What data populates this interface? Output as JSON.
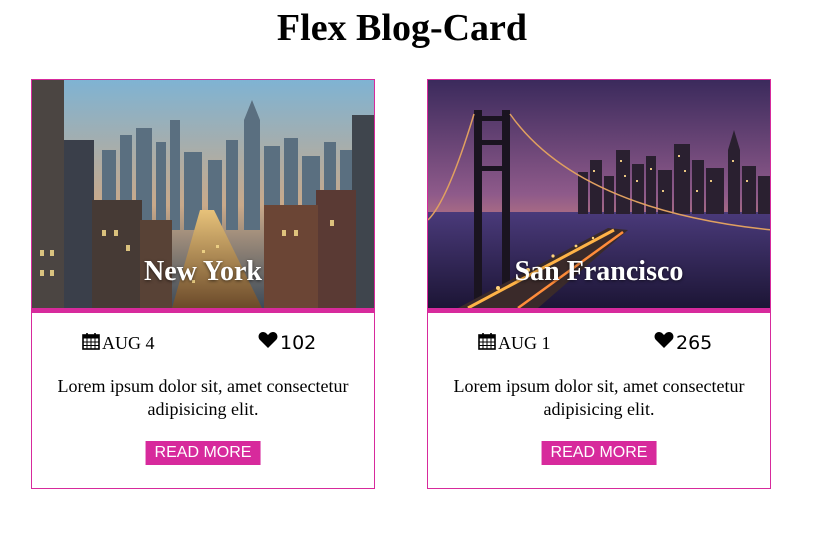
{
  "page": {
    "title": "Flex Blog-Card"
  },
  "accent_color": "#d72a9c",
  "cards": [
    {
      "city": "New York",
      "date": "AUG 4",
      "likes": "102",
      "description": "Lorem ipsum dolor sit, amet consectetur adipisicing elit.",
      "button_label": "READ MORE",
      "date_icon": "calendar-icon",
      "likes_icon": "heart-icon"
    },
    {
      "city": "San Francisco",
      "date": "AUG 1",
      "likes": "265",
      "description": "Lorem ipsum dolor sit, amet consectetur adipisicing elit.",
      "button_label": "READ MORE",
      "date_icon": "calendar-icon",
      "likes_icon": "heart-icon"
    }
  ]
}
